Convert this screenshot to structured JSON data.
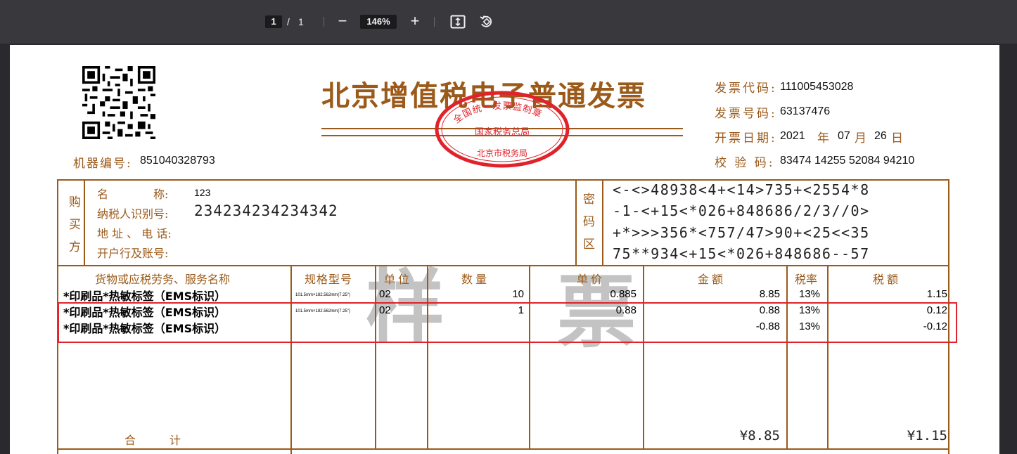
{
  "toolbar": {
    "page_current": "1",
    "page_separator": "/",
    "page_total": "1",
    "zoom_out": "−",
    "zoom_level": "146%",
    "zoom_in": "+",
    "fit_icon": "fit-page-icon",
    "rotate_icon": "rotate-icon"
  },
  "invoice": {
    "title": "北京增值税电子普通发票",
    "machine_no_label": "机器编号:",
    "machine_no": "851040328793",
    "code_label": "发票代码:",
    "code": "111005453028",
    "number_label": "发票号码:",
    "number": "63137476",
    "date_label": "开票日期:",
    "date_year": "2021",
    "date_year_unit": "年",
    "date_month": "07",
    "date_month_unit": "月",
    "date_day": "26",
    "date_day_unit": "日",
    "check_label": "校 验 码:",
    "check_code": "83474 14255 52084 94210",
    "seal": {
      "top": "全国统一发票监制章",
      "middle": "国家税务总局",
      "bottom": "北京市税务局"
    }
  },
  "buyer": {
    "section_label": [
      "购",
      "买",
      "方"
    ],
    "name_label": "名　　　　称:",
    "name": "123",
    "tax_id_label": "纳税人识别号:",
    "tax_id": "234234234234342",
    "address_label": "地 址 、 电 话:",
    "bank_label": "开户行及账号:"
  },
  "cipher": {
    "section_label": [
      "密",
      "码",
      "区"
    ],
    "lines": [
      "<-<>48938<4+<14>735+<2554*8",
      "-1-<+15<*026+848686/2/3//0>",
      "+*>>>356*<757/47>90+<25<<35",
      "75**934<+15<*026+848686--57"
    ]
  },
  "items_table": {
    "headers": [
      "货物或应税劳务、服务名称",
      "规格型号",
      "单位",
      "数量",
      "单价",
      "金额",
      "税率",
      "税额"
    ],
    "rows": [
      {
        "name": "*印刷品*热敏标签（EMS标识）",
        "spec": "101.5mm×182.562mm(7.25\")",
        "unit": "02",
        "qty": "10",
        "price": "0.885",
        "amount": "8.85",
        "rate": "13%",
        "tax": "1.15"
      },
      {
        "name": "*印刷品*热敏标签（EMS标识）",
        "spec": "101.5mm×182.562mm(7.25\")",
        "unit": "02",
        "qty": "1",
        "price": "0.88",
        "amount": "0.88",
        "rate": "13%",
        "tax": "0.12"
      },
      {
        "name": "*印刷品*热敏标签（EMS标识）",
        "spec": "",
        "unit": "",
        "qty": "",
        "price": "",
        "amount": "-0.88",
        "rate": "13%",
        "tax": "-0.12"
      }
    ],
    "total_label": "合　　　计",
    "total_amount": "¥8.85",
    "total_tax": "¥1.15"
  },
  "watermark": [
    "样",
    "票"
  ],
  "colors": {
    "accent": "#9b5a1a",
    "seal": "#e0232a",
    "toolbar": "#38383d",
    "highlight": "#e0232a"
  }
}
